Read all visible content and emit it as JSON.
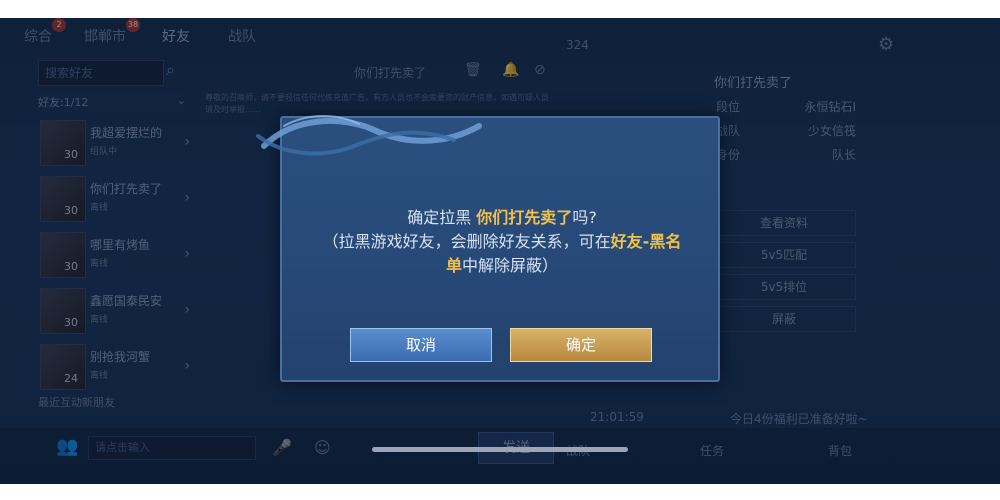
{
  "top_tabs": [
    {
      "label": "综合",
      "badge": "2"
    },
    {
      "label": "邯郸市",
      "badge": "38"
    },
    {
      "label": "好友",
      "badge": ""
    },
    {
      "label": "战队",
      "badge": ""
    }
  ],
  "search": {
    "placeholder": "搜索好友"
  },
  "friends_header": "好友:1/12",
  "friends": [
    {
      "name": "我超爱摆烂的",
      "level": "30",
      "status": "组队中"
    },
    {
      "name": "你们打先卖了",
      "level": "30",
      "status": "离线"
    },
    {
      "name": "哪里有烤鱼",
      "level": "30",
      "status": "离线"
    },
    {
      "name": "鑫愿国泰民安",
      "level": "30",
      "status": "离线"
    },
    {
      "name": "别抢我河蟹",
      "level": "24",
      "status": "离线"
    }
  ],
  "recent_header": "最近互动新朋友",
  "chat": {
    "title": "你们打先卖了",
    "notice": "尊敬的召唤师，请不要轻信任何代练充值广告，有方人员也不会索要您的财产信息，如遇可疑人员请及时举报……"
  },
  "profile": {
    "top_number": "324",
    "name": "你们打先卖了",
    "rows": [
      {
        "key": "段位",
        "value": "永恒钻石I"
      },
      {
        "key": "战队",
        "value": "少女信筏"
      },
      {
        "key": "身份",
        "value": "队长"
      }
    ],
    "buttons": [
      "查看资料",
      "5v5匹配",
      "5v5排位",
      "屏蔽"
    ]
  },
  "bottom": {
    "input_placeholder": "请点击输入",
    "send_label": "发送",
    "team_label": "战队",
    "task_label": "任务",
    "bag_label": "背包",
    "time_text": "21:01:59",
    "welfare_text": "今日4份福利已准备好啦~"
  },
  "modal": {
    "line1_prefix": "确定拉黑",
    "line1_name": "你们打先卖了",
    "line1_suffix": "吗?",
    "line2_prefix": "（拉黑游戏好友，会删除好友关系，可在",
    "line2_highlight_a": "好友-黑名",
    "line3_highlight_b": "单",
    "line3_suffix": "中解除屏蔽）",
    "cancel_label": "取消",
    "confirm_label": "确定"
  },
  "colors": {
    "highlight": "#f2c14a",
    "cancel_button": "#3a6cb0",
    "confirm_button": "#b7893f"
  }
}
